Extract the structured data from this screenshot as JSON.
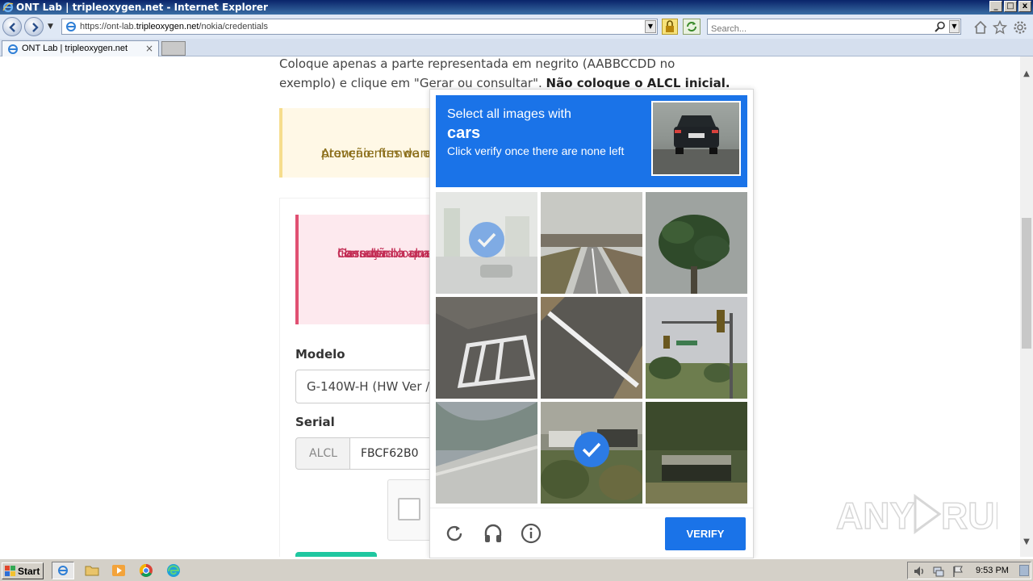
{
  "window": {
    "title": "ONT Lab | tripleoxygen.net - Internet Explorer",
    "controls": [
      "_",
      "□",
      "x"
    ]
  },
  "navbar": {
    "url_prefix": "https://ont-lab.",
    "url_domain": "tripleoxygen.net",
    "url_path": "/nokia/credentials",
    "search_placeholder": "Search..."
  },
  "tab": {
    "label": "ONT Lab | tripleoxygen.net",
    "close": "×"
  },
  "page": {
    "intro_pre": "Coloque apenas a parte representada em negrito (AABBCCDD no exemplo) e clique em \"Gerar ou consultar\".",
    "intro_bold": "Não coloque o ALCL inicial.",
    "warning": "Atenção: firmwares ser... provenientes de outro...",
    "warning_line1": "Atenção: firmwares ser",
    "warning_line2": "provenientes de outro",
    "danger_line1": "Gerador bloqueado",
    "danger_line2": "liberação.",
    "danger_line3": "Caso tenha um seria",
    "danger_line4": "consulta-lo abaixo s",
    "model_label": "Modelo",
    "model_value": "G-140W-H (HW Ver /",
    "serial_label": "Serial",
    "serial_prefix": "ALCL",
    "serial_value": "FBCF62B0"
  },
  "captcha": {
    "prompt_line1": "Select all images with",
    "prompt_target": "cars",
    "prompt_line3": "Click verify once there are none left",
    "verify_label": "VERIFY",
    "tiles": [
      {
        "name": "tile-parking-lot",
        "selected": true
      },
      {
        "name": "tile-road-overpass",
        "selected": false
      },
      {
        "name": "tile-palm-tree",
        "selected": false
      },
      {
        "name": "tile-crosswalk",
        "selected": false
      },
      {
        "name": "tile-road-lines",
        "selected": false
      },
      {
        "name": "tile-traffic-light",
        "selected": false
      },
      {
        "name": "tile-bridge-structure",
        "selected": false
      },
      {
        "name": "tile-car-bushes",
        "selected": true
      },
      {
        "name": "tile-overpass-hedge",
        "selected": false
      }
    ],
    "colors": {
      "accent": "#1a73e8",
      "check": "#2c7be5"
    }
  },
  "watermark": "ANY RUN",
  "taskbar": {
    "start_label": "Start",
    "clock": "9:53 PM"
  }
}
